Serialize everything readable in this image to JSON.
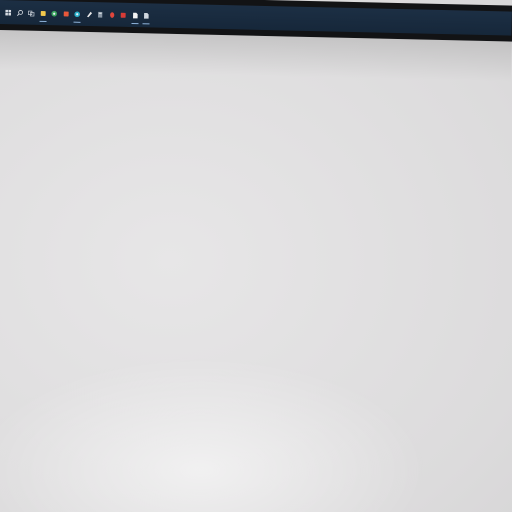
{
  "taskbar": {
    "background_color": "#1c2f44",
    "items": [
      {
        "icon": "windows-start-icon",
        "color": "#d8dde4",
        "running": false
      },
      {
        "icon": "search-icon",
        "color": "#d8dde4",
        "running": false
      },
      {
        "icon": "task-view-icon",
        "color": "#c9d0d8",
        "running": false
      },
      {
        "icon": "file-explorer-icon",
        "color": "#f2c94c",
        "running": true
      },
      {
        "icon": "chrome-icon",
        "color": "#3ba55d",
        "running": false
      },
      {
        "icon": "office-icon",
        "color": "#e8583a",
        "running": false
      },
      {
        "icon": "edge-icon",
        "color": "#2bb0c9",
        "running": true
      },
      {
        "icon": "paint-icon",
        "color": "#e9e9e9",
        "running": false
      },
      {
        "icon": "calculator-icon",
        "color": "#8a96a3",
        "running": false
      },
      {
        "icon": "red-app-icon",
        "color": "#e0463c",
        "running": false
      },
      {
        "icon": "pdf-reader-icon",
        "color": "#d63b36",
        "running": false
      },
      {
        "icon": "document-icon",
        "color": "#f3f3f3",
        "running": true
      },
      {
        "icon": "notepad-icon",
        "color": "#cfd6de",
        "running": true
      }
    ]
  },
  "colors": {
    "wall": "#dfdedf",
    "bezel": "#121315"
  }
}
